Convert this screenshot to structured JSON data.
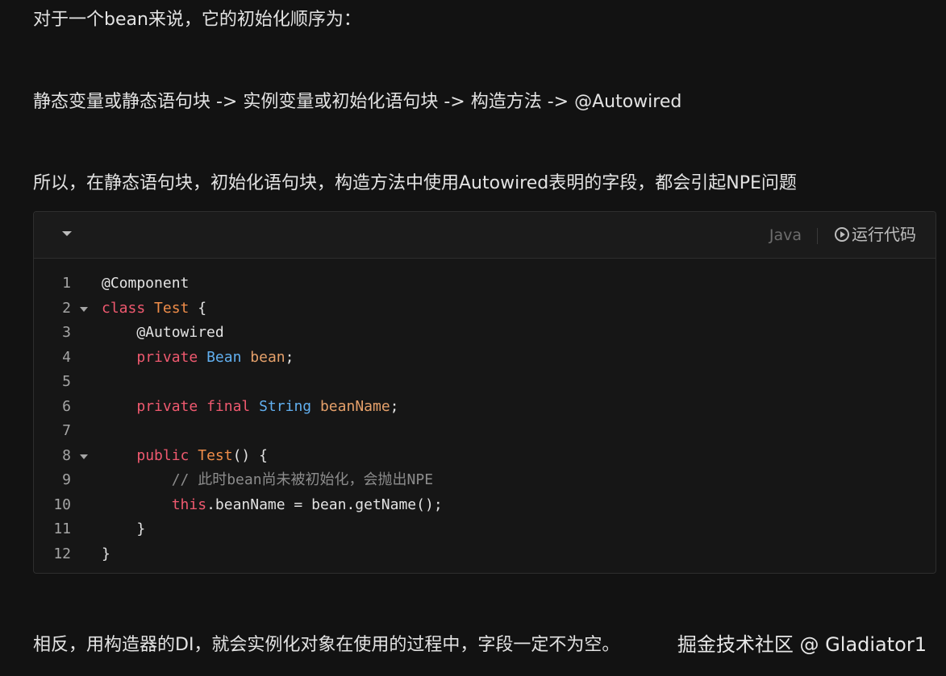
{
  "article": {
    "p1": "对于一个bean来说，它的初始化顺序为：",
    "p2": "静态变量或静态语句块 -> 实例变量或初始化语句块 -> 构造方法 -> @Autowired",
    "p3": "所以，在静态语句块，初始化语句块，构造方法中使用Autowired表明的字段，都会引起NPE问题",
    "p4": "相反，用构造器的DI，就会实例化对象在使用的过程中，字段一定不为空。"
  },
  "watermark": "掘金技术社区 @ Gladiator1",
  "code_block": {
    "language": "Java",
    "run_label": "运行代码",
    "icons": {
      "collapse": "caret-down-icon",
      "run": "play-circle-icon",
      "fold": "fold-caret-icon"
    },
    "colors": {
      "keyword": "#ef596f",
      "class": "#e5c07b",
      "type": "#61afef",
      "comment": "#8c8c8c"
    },
    "lines": [
      {
        "num": "1",
        "fold": false,
        "tokens": [
          [
            "ann",
            "@Component"
          ]
        ]
      },
      {
        "num": "2",
        "fold": true,
        "tokens": [
          [
            "kw",
            "class"
          ],
          [
            "pl",
            " "
          ],
          [
            "cls2",
            "Test"
          ],
          [
            "pl",
            " {"
          ]
        ]
      },
      {
        "num": "3",
        "fold": false,
        "tokens": [
          [
            "pl",
            "    "
          ],
          [
            "ann",
            "@Autowired"
          ]
        ]
      },
      {
        "num": "4",
        "fold": false,
        "tokens": [
          [
            "pl",
            "    "
          ],
          [
            "kw",
            "private"
          ],
          [
            "pl",
            " "
          ],
          [
            "type",
            "Bean"
          ],
          [
            "pl",
            " "
          ],
          [
            "var",
            "bean"
          ],
          [
            "pl",
            ";"
          ]
        ]
      },
      {
        "num": "5",
        "fold": false,
        "tokens": []
      },
      {
        "num": "6",
        "fold": false,
        "tokens": [
          [
            "pl",
            "    "
          ],
          [
            "kw",
            "private"
          ],
          [
            "pl",
            " "
          ],
          [
            "kw",
            "final"
          ],
          [
            "pl",
            " "
          ],
          [
            "type",
            "String"
          ],
          [
            "pl",
            " "
          ],
          [
            "var",
            "beanName"
          ],
          [
            "pl",
            ";"
          ]
        ]
      },
      {
        "num": "7",
        "fold": false,
        "tokens": []
      },
      {
        "num": "8",
        "fold": true,
        "tokens": [
          [
            "pl",
            "    "
          ],
          [
            "kw",
            "public"
          ],
          [
            "pl",
            " "
          ],
          [
            "cls2",
            "Test"
          ],
          [
            "pl",
            "() {"
          ]
        ]
      },
      {
        "num": "9",
        "fold": false,
        "tokens": [
          [
            "pl",
            "        "
          ],
          [
            "cmt",
            "// 此时bean尚未被初始化，会抛出NPE"
          ]
        ]
      },
      {
        "num": "10",
        "fold": false,
        "tokens": [
          [
            "pl",
            "        "
          ],
          [
            "kw",
            "this"
          ],
          [
            "pl",
            ".beanName = bean.getName();"
          ]
        ]
      },
      {
        "num": "11",
        "fold": false,
        "tokens": [
          [
            "pl",
            "    }"
          ]
        ]
      },
      {
        "num": "12",
        "fold": false,
        "tokens": [
          [
            "pl",
            "}"
          ]
        ]
      }
    ]
  }
}
